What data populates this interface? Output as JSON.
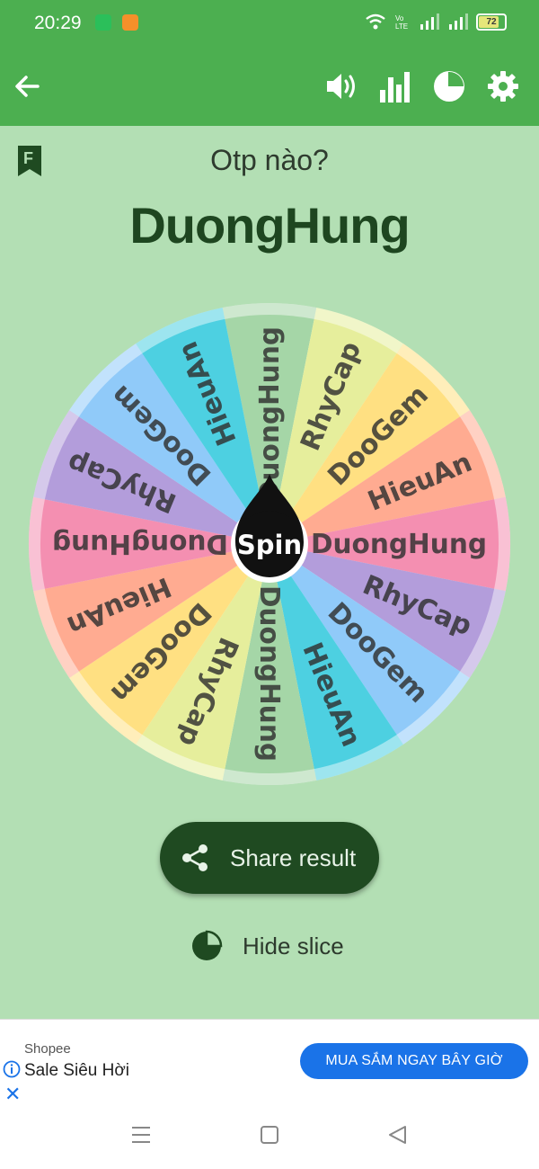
{
  "status_bar": {
    "time": "20:29",
    "network_label": "Vo\nLTE",
    "battery_level": "72"
  },
  "app_bar": {
    "icons": [
      "back-arrow-icon",
      "volume-icon",
      "bar-chart-icon",
      "pie-chart-icon",
      "gear-icon"
    ]
  },
  "main": {
    "question": "Otp nào?",
    "result": "DuongHung",
    "bookmark_letter": "F",
    "spin_label": "Spin",
    "share_label": "Share result",
    "hide_slice_label": "Hide slice"
  },
  "wheel": {
    "slices": [
      {
        "label": "DuongHung",
        "color": "#a5d6a7"
      },
      {
        "label": "RhyCap",
        "color": "#e6ee9c"
      },
      {
        "label": "DooGem",
        "color": "#ffe082"
      },
      {
        "label": "HieuAn",
        "color": "#ffab91"
      },
      {
        "label": "DuongHung",
        "color": "#f48fb1"
      },
      {
        "label": "RhyCap",
        "color": "#b39ddb"
      },
      {
        "label": "DooGem",
        "color": "#90caf9"
      },
      {
        "label": "HieuAn",
        "color": "#4dd0e1"
      },
      {
        "label": "DuongHung",
        "color": "#a5d6a7"
      },
      {
        "label": "RhyCap",
        "color": "#e6ee9c"
      },
      {
        "label": "DooGem",
        "color": "#ffe082"
      },
      {
        "label": "HieuAn",
        "color": "#ffab91"
      },
      {
        "label": "DuongHung",
        "color": "#f48fb1"
      },
      {
        "label": "RhyCap",
        "color": "#b39ddb"
      },
      {
        "label": "DooGem",
        "color": "#90caf9"
      },
      {
        "label": "HieuAn",
        "color": "#4dd0e1"
      }
    ]
  },
  "ad": {
    "brand": "Shopee",
    "title": "Sale Siêu Hời",
    "cta": "MUA SẮM NGAY BÂY GIỜ"
  },
  "colors": {
    "primary": "#4caf50",
    "background": "#b3dfb4",
    "dark": "#1f4a21",
    "ad_button": "#1a73e8"
  }
}
